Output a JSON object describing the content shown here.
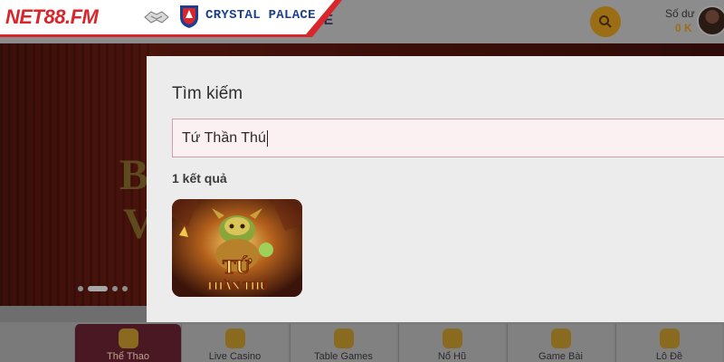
{
  "brand": {
    "site_logo_text": "NET88.FM",
    "partner_name": "CRYSTAL PALACE",
    "partner_tail": "CE"
  },
  "header": {
    "balance_label": "Số dư",
    "balance_value": "0 K"
  },
  "search_modal": {
    "title": "Tìm kiếm",
    "query": "Tứ Thần Thú",
    "result_count": "1 kết quả",
    "results": [
      {
        "title_art": "TỨ THẦN THÚ",
        "image": "game-thumbnail"
      }
    ]
  },
  "categories": [
    {
      "label": "Thể Thao",
      "icon": "ball-icon",
      "active": true
    },
    {
      "label": "Live Casino",
      "icon": "cards-icon",
      "active": false
    },
    {
      "label": "Table Games",
      "icon": "chest-icon",
      "active": false
    },
    {
      "label": "Nổ Hũ",
      "icon": "seven-icon",
      "active": false
    },
    {
      "label": "Game Bài",
      "icon": "card-hand-icon",
      "active": false
    },
    {
      "label": "Lô Đề",
      "icon": "lotto-ball-icon",
      "active": false
    }
  ],
  "colors": {
    "brand_red": "#d8262c",
    "partner_blue": "#1b3f8f",
    "gold": "#9b6d14",
    "modal_bg": "#ececec",
    "input_border": "#d2a0ad"
  }
}
